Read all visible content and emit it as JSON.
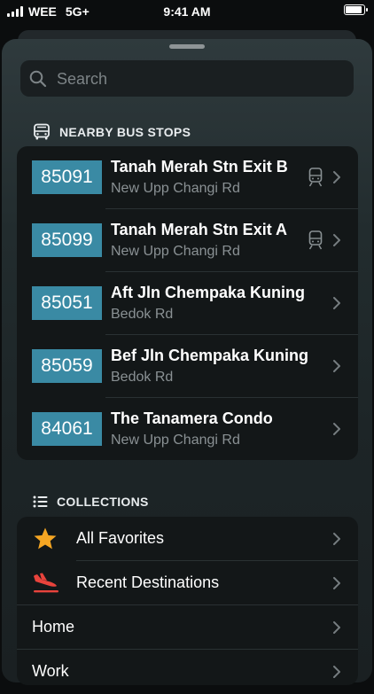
{
  "status_bar": {
    "carrier": "WEE",
    "network": "5G+",
    "time": "9:41 AM"
  },
  "search": {
    "placeholder": "Search"
  },
  "nearby": {
    "title": "NEARBY BUS STOPS",
    "stops": [
      {
        "code": "85091",
        "name": "Tanah Merah Stn Exit B",
        "road": "New Upp Changi Rd",
        "train": true
      },
      {
        "code": "85099",
        "name": "Tanah Merah Stn Exit A",
        "road": "New Upp Changi Rd",
        "train": true
      },
      {
        "code": "85051",
        "name": "Aft Jln Chempaka Kuning",
        "road": "Bedok Rd",
        "train": false
      },
      {
        "code": "85059",
        "name": "Bef Jln Chempaka Kuning",
        "road": "Bedok Rd",
        "train": false
      },
      {
        "code": "84061",
        "name": "The Tanamera Condo",
        "road": "New Upp Changi Rd",
        "train": false
      }
    ]
  },
  "collections": {
    "title": "COLLECTIONS",
    "items": [
      {
        "label": "All Favorites",
        "icon": "star-icon"
      },
      {
        "label": "Recent Destinations",
        "icon": "plane-landing-icon"
      },
      {
        "label": "Home"
      },
      {
        "label": "Work"
      }
    ]
  },
  "colors": {
    "accent": "#3a8aa4",
    "star": "#f5a623",
    "plane": "#e8433c"
  }
}
